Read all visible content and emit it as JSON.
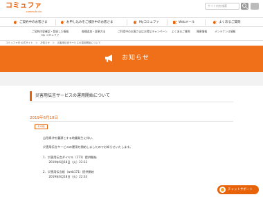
{
  "header": {
    "logo_main": "コミュファ",
    "logo_sub": "commufa ctc",
    "search_placeholder": "サイト内を検索"
  },
  "mainnav": {
    "items": [
      {
        "label": "ご契約中のお客さま"
      },
      {
        "label": "お申し込みをご検討中のお客さま"
      },
      {
        "label": "Myコミュファ"
      },
      {
        "label": "Webメール"
      },
      {
        "label": "よくあるご質問"
      }
    ]
  },
  "subnav": {
    "items": [
      {
        "line1": "ご契約内容確認・登録した情報",
        "line2": "My コミュファ"
      },
      {
        "line1": "各種追加・変更方法",
        "line2": ""
      },
      {
        "line1": "ご利用中のお客さまはお得なキャンペーン",
        "line2": ""
      },
      {
        "line1": "よくあるご質問",
        "line2": ""
      },
      {
        "line1": "障害情報",
        "line2": ""
      },
      {
        "line1": "メンテナンス情報",
        "line2": ""
      }
    ]
  },
  "breadcrumb": "コミュファ光 公式サイト　＞　お知らせ　＞　災害用伝言サービスの運用開始について",
  "banner": {
    "title": "お知らせ",
    "icon": "megaphone-icon"
  },
  "article": {
    "title": "災害用伝言サービスの運用開始について",
    "date": "2019年6月18日",
    "badge": "その他",
    "lines": [
      "山形県沖を震源とする地震発生に伴い、",
      "",
      "災害用伝言サービスの運用を開始しましたのでお知らせいたします。",
      "",
      "1．災害用伝言ダイヤル（171）提供開始",
      "　　2019年6月18日（火）22:33",
      "",
      "2．災害用伝言板（web171）提供開始",
      "　　2019年6月18日（火）22:33"
    ]
  },
  "chat": {
    "label": "チャットサポート"
  },
  "colors": {
    "accent": "#e8620a",
    "banner": "#f0701a"
  }
}
